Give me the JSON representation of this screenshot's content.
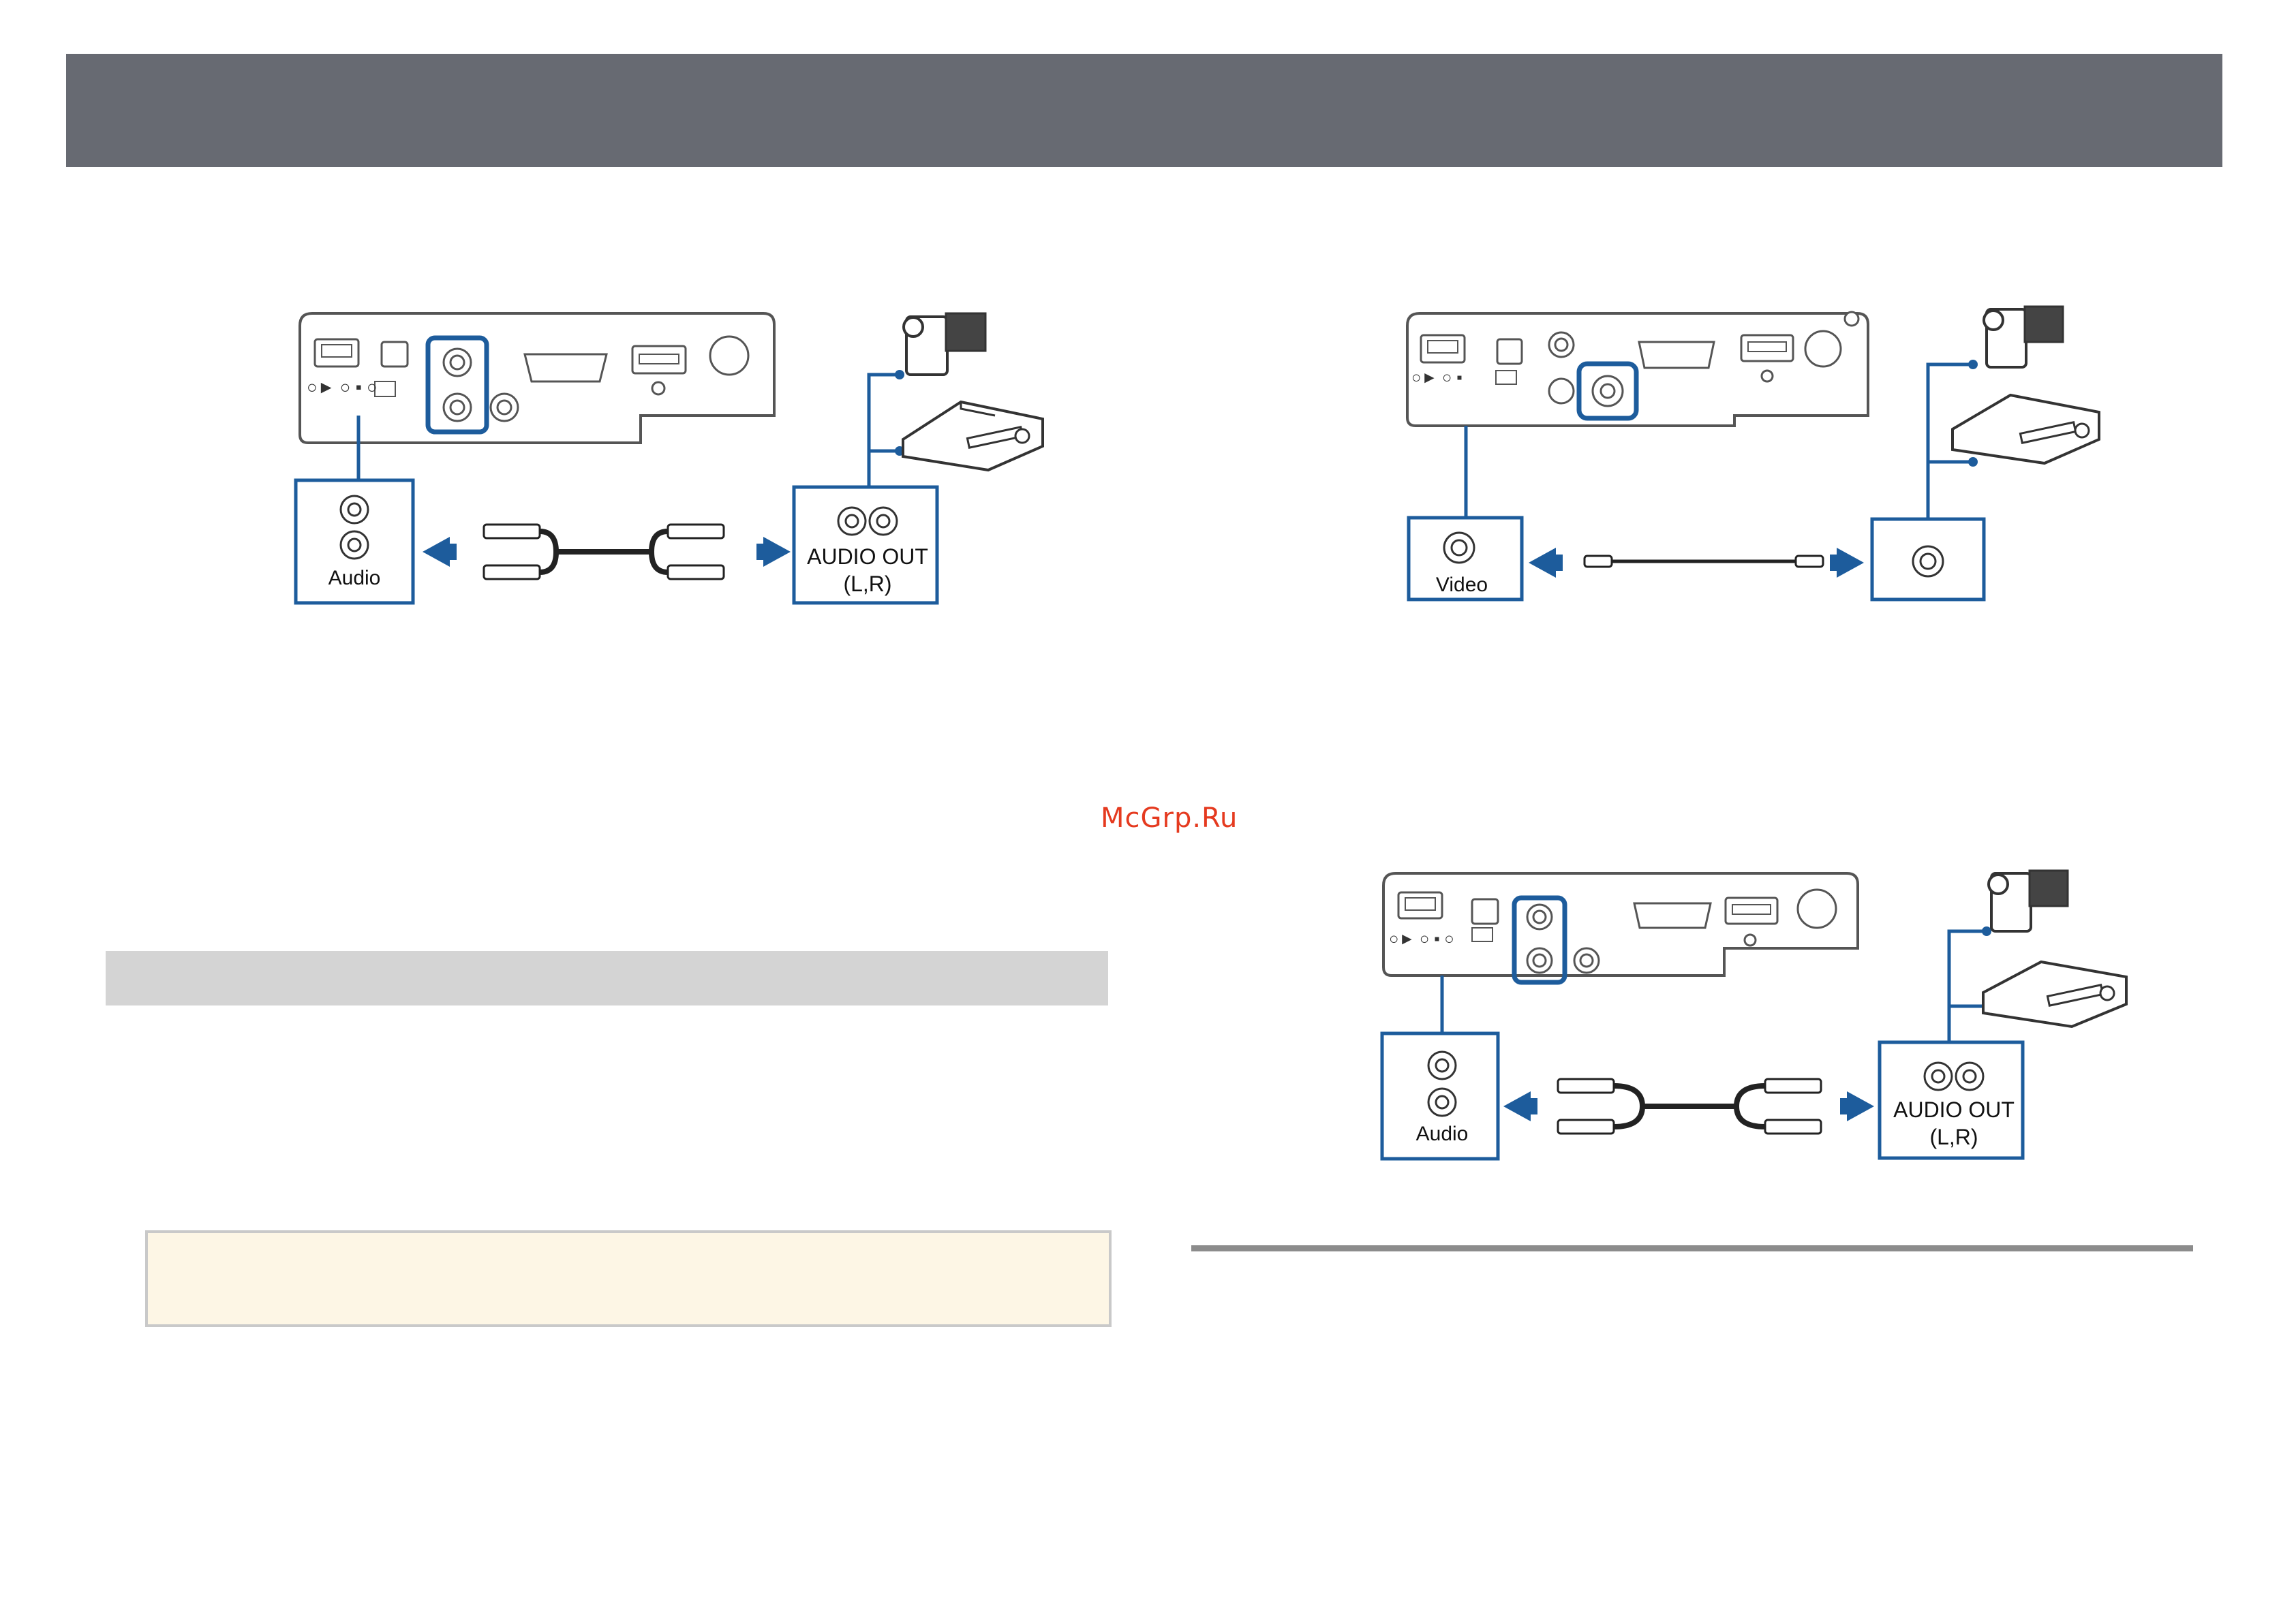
{
  "watermark": "McGrp.Ru",
  "figures": {
    "audio_top": {
      "projector_port": "Audio",
      "device_port": "AUDIO OUT",
      "device_port_sub": "(L,R)"
    },
    "video_top": {
      "projector_port": "Video"
    },
    "audio_bottom": {
      "projector_port": "Audio",
      "device_port": "AUDIO OUT",
      "device_port_sub": "(L,R)"
    }
  },
  "colors": {
    "header": "#676a72",
    "accent_blue": "#1d5c9c",
    "section_bar": "#d4d4d4",
    "note_bg": "#fdf6e5",
    "rule": "#8c8c8c"
  }
}
